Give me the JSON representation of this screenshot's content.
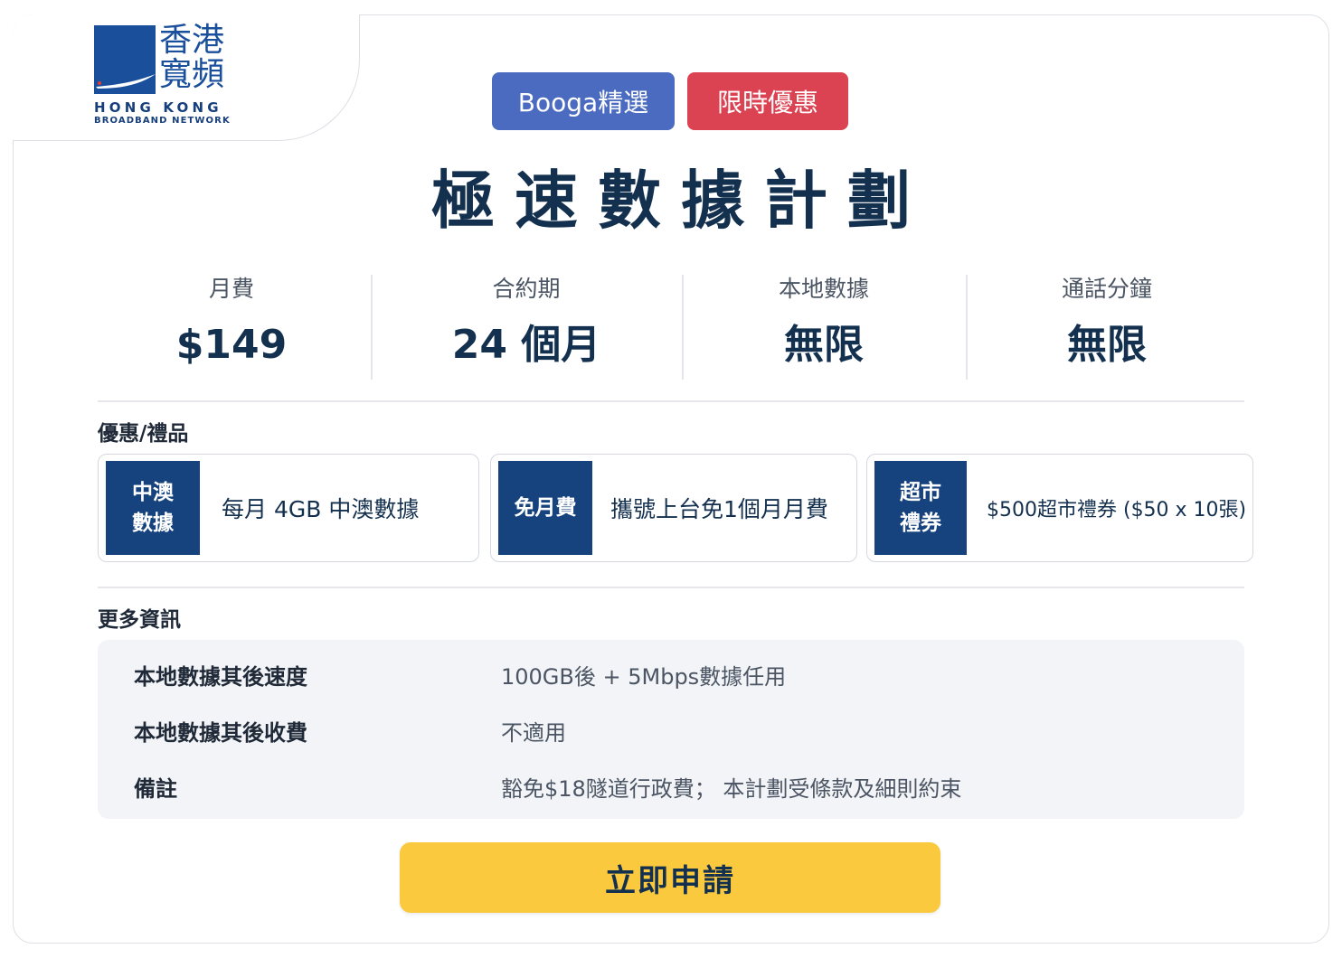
{
  "brand": {
    "logo_cn": "香港寬頻",
    "logo_en_line1": "HONG KONG",
    "logo_en_line2": "BROADBAND NETWORK"
  },
  "badges": [
    {
      "label": "Booga精選",
      "color": "#4a6bbf"
    },
    {
      "label": "限時優惠",
      "color": "#dc4352"
    }
  ],
  "plan": {
    "title": "極速數據計劃",
    "stats": [
      {
        "label": "月費",
        "value": "$149"
      },
      {
        "label": "合約期",
        "value": "24 個月"
      },
      {
        "label": "本地數據",
        "value": "無限"
      },
      {
        "label": "通話分鐘",
        "value": "無限"
      }
    ]
  },
  "offers": {
    "title": "優惠/禮品",
    "items": [
      {
        "tag_line1": "中澳",
        "tag_line2": "數據",
        "text": "每月 4GB 中澳數據"
      },
      {
        "tag_line1": "免月費",
        "tag_line2": "",
        "text": "攜號上台免1個月月費"
      },
      {
        "tag_line1": "超市",
        "tag_line2": "禮券",
        "text": "$500超市禮券 ($50 x 10張)"
      }
    ]
  },
  "more_info": {
    "title": "更多資訊",
    "rows": [
      {
        "key": "本地數據其後速度",
        "value": "100GB後 + 5Mbps數據任用"
      },
      {
        "key": "本地數據其後收費",
        "value": "不適用"
      },
      {
        "key": "備註",
        "value": "豁免$18隧道行政費； 本計劃受條款及細則約束"
      }
    ]
  },
  "cta": {
    "label": "立即申請",
    "color": "#fbc93d"
  },
  "colors": {
    "navy": "#14304f",
    "brand_blue": "#1a4f9c",
    "tag_blue": "#16437e"
  }
}
